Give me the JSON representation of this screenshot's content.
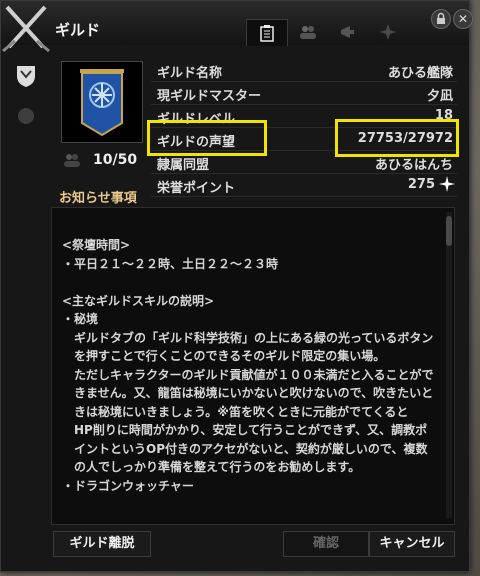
{
  "window": {
    "title": "ギルド"
  },
  "guild": {
    "member_count": "10/50",
    "fields": [
      {
        "label": "ギルド名称",
        "value": "あひる艦隊"
      },
      {
        "label": "現ギルドマスター",
        "value": "夕凪"
      },
      {
        "label": "ギルドレベル",
        "value": "18"
      },
      {
        "label": "ギルドの声望",
        "value": "27753/27972"
      },
      {
        "label": "隷属同盟",
        "value": "あひるはんち"
      },
      {
        "label": "栄誉ポイント",
        "value": "275"
      }
    ]
  },
  "notice": {
    "heading": "お知らせ事項",
    "lines": [
      "<祭壇時間>",
      "・平日２１～２２時、土日２２～２３時",
      "",
      "<主なギルドスキルの説明>",
      "・秘境",
      "　ギルドタブの「ギルド科学技術」の上にある緑の光っているボタン",
      "　を押すことで行くことのできるそのギルド限定の集い場。",
      "　ただしキャラクターのギルド貢献値が１００未満だと入ることがで",
      "　きません。又、龍笛は秘境にいかないと吹けないので、吹きたいと",
      "　きは秘境にいきましょう。※笛を吹くときに元能がでてくると",
      "　HP削りに時間がかかり、安定して行うことができず、又、調教ポ",
      "　イントというOP付きのアクセがないと、契約が厳しいので、複数",
      "　の人でしっかり準備を整えて行うのをお勧めします。",
      "・ドラゴンウォッチャー"
    ]
  },
  "buttons": {
    "leave": "ギルド離脱",
    "confirm": "確認",
    "cancel": "キャンセル"
  },
  "colors": {
    "highlight": "#f1e400",
    "section_heading": "#e9c88a"
  }
}
